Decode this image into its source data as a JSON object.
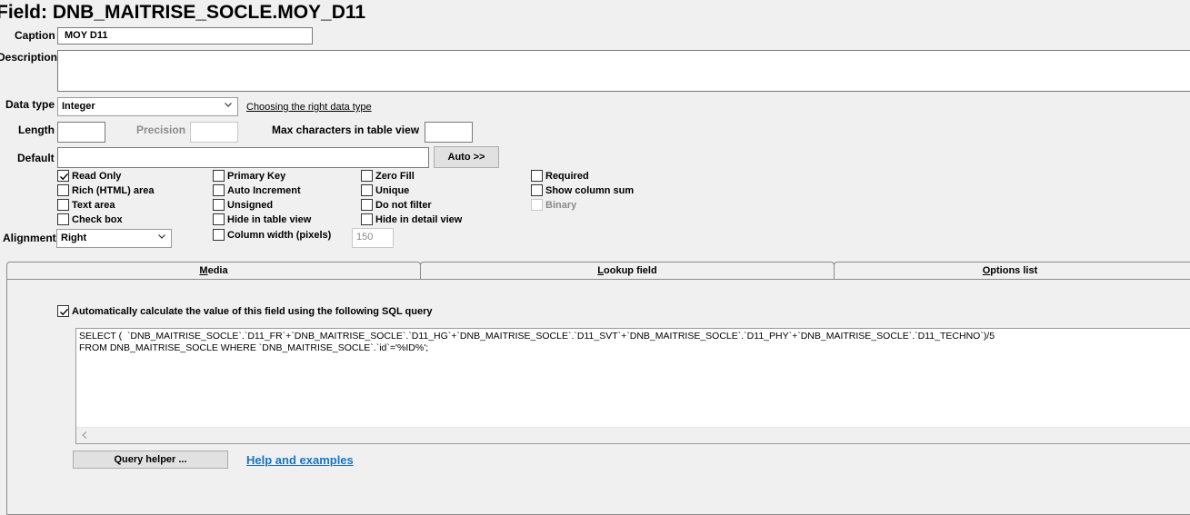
{
  "title": "Field: DNB_MAITRISE_SOCLE.MOY_D11",
  "caption": {
    "label": "Caption",
    "value": "MOY D11"
  },
  "description": {
    "label": "Description",
    "value": ""
  },
  "data_type": {
    "label": "Data type",
    "value": "Integer",
    "help_link": "Choosing the right data type"
  },
  "length": {
    "label": "Length",
    "value": ""
  },
  "precision": {
    "label": "Precision",
    "value": ""
  },
  "max_chars": {
    "label": "Max characters in table view",
    "value": ""
  },
  "default": {
    "label": "Default",
    "value": "",
    "auto_button": "Auto >>"
  },
  "checkboxes": {
    "read_only": {
      "label": "Read Only",
      "checked": true
    },
    "rich_html": {
      "label": "Rich (HTML) area",
      "checked": false
    },
    "text_area": {
      "label": "Text area",
      "checked": false
    },
    "check_box": {
      "label": "Check box",
      "checked": false
    },
    "primary_key": {
      "label": "Primary Key",
      "checked": false
    },
    "auto_increment": {
      "label": "Auto Increment",
      "checked": false
    },
    "unsigned": {
      "label": "Unsigned",
      "checked": false
    },
    "hide_table_view": {
      "label": "Hide in table view",
      "checked": false
    },
    "column_width": {
      "label": "Column width (pixels)",
      "checked": false,
      "value": "150"
    },
    "zero_fill": {
      "label": "Zero Fill",
      "checked": false
    },
    "unique": {
      "label": "Unique",
      "checked": false
    },
    "do_not_filter": {
      "label": "Do not filter",
      "checked": false
    },
    "hide_detail_view": {
      "label": "Hide in detail view",
      "checked": false
    },
    "required": {
      "label": "Required",
      "checked": false
    },
    "show_column_sum": {
      "label": "Show column sum",
      "checked": false
    },
    "binary": {
      "label": "Binary",
      "checked": false,
      "disabled": true
    }
  },
  "alignment": {
    "label": "Alignment",
    "value": "Right"
  },
  "tabs": [
    {
      "label": "Media",
      "accel": "M",
      "rest": "edia"
    },
    {
      "label": "Lookup field",
      "accel": "L",
      "rest": "ookup field"
    },
    {
      "label": "Options list",
      "accel": "O",
      "rest": "ptions list"
    }
  ],
  "auto_calc": {
    "checked": true,
    "label": "Automatically calculate the value of this field using the following SQL query",
    "sql_line1": "SELECT (  `DNB_MAITRISE_SOCLE`.`D11_FR`+`DNB_MAITRISE_SOCLE`.`D11_HG`+`DNB_MAITRISE_SOCLE`.`D11_SVT`+`DNB_MAITRISE_SOCLE`.`D11_PHY`+`DNB_MAITRISE_SOCLE`.`D11_TECHNO`)/5",
    "sql_line2": "FROM DNB_MAITRISE_SOCLE WHERE `DNB_MAITRISE_SOCLE`.`id`='%ID%';",
    "query_helper_button": "Query helper ...",
    "help_link": "Help and examples"
  },
  "icons": {
    "checkmark": "check-icon",
    "dropdown": "chevron-down-icon",
    "scroll_left": "chevron-left-icon"
  },
  "colors": {
    "background": "#f0f0f0",
    "link_blue": "#1a74c0",
    "disabled_text": "#8a8a8a"
  }
}
